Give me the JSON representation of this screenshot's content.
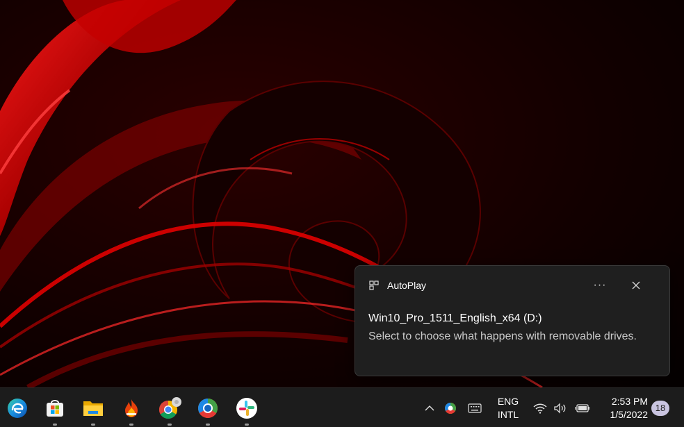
{
  "toast": {
    "app_name": "AutoPlay",
    "app_icon": "autoplay-icon",
    "more_label": "···",
    "title": "Win10_Pro_1511_English_x64 (D:)",
    "body": "Select to choose what happens with removable drives."
  },
  "taskbar": {
    "apps": [
      {
        "name": "edge",
        "icon": "edge-icon",
        "running": false
      },
      {
        "name": "microsoft-store",
        "icon": "store-icon",
        "running": true
      },
      {
        "name": "file-explorer",
        "icon": "folder-icon",
        "running": true
      },
      {
        "name": "hot-app",
        "icon": "flame-icon",
        "running": true
      },
      {
        "name": "chrome",
        "icon": "chrome-icon",
        "running": true
      },
      {
        "name": "chrome-canary",
        "icon": "chrome-canary-icon",
        "running": true
      },
      {
        "name": "slack",
        "icon": "slack-icon",
        "running": true
      }
    ]
  },
  "tray": {
    "language_line1": "ENG",
    "language_line2": "INTL",
    "time": "2:53 PM",
    "date": "1/5/2022",
    "notification_count": "18"
  },
  "colors": {
    "wallpaper_accent": "#d10000",
    "toast_bg": "#1f1f1f",
    "taskbar_bg": "#1c1c1c"
  }
}
